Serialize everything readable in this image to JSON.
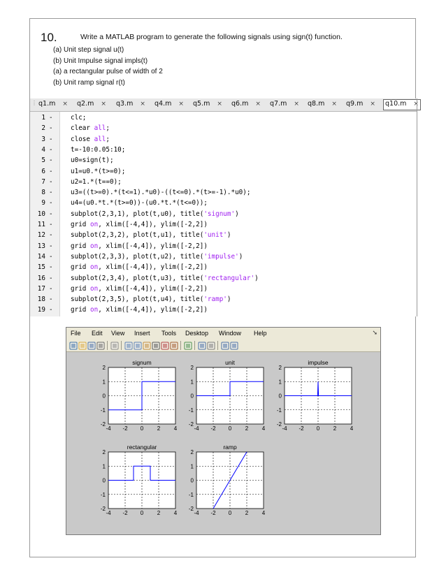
{
  "question": {
    "number": "10.",
    "text": "Write a MATLAB program to generate the following signals using sign(t) function.",
    "items": [
      "(a) Unit step signal u(t)",
      "(b) Unit Impulse signal impls(t)",
      "(a) a rectangular pulse of width of 2",
      "(b) Unit ramp signal r(t)"
    ]
  },
  "editor": {
    "tabs": [
      {
        "label": "q1.m"
      },
      {
        "label": "q2.m"
      },
      {
        "label": "q3.m"
      },
      {
        "label": "q4.m"
      },
      {
        "label": "q5.m"
      },
      {
        "label": "q6.m"
      },
      {
        "label": "q7.m"
      },
      {
        "label": "q8.m"
      },
      {
        "label": "q9.m"
      },
      {
        "label": "q10.m",
        "active": true
      }
    ],
    "close_glyph": "×",
    "lines": [
      {
        "num": "1",
        "code": [
          [
            "clc;",
            ""
          ]
        ]
      },
      {
        "num": "2",
        "code": [
          [
            "clear ",
            ""
          ],
          [
            "all",
            "kw"
          ],
          [
            ";",
            ""
          ]
        ]
      },
      {
        "num": "3",
        "code": [
          [
            "close ",
            ""
          ],
          [
            "all",
            "kw"
          ],
          [
            ";",
            ""
          ]
        ]
      },
      {
        "num": "4",
        "code": [
          [
            "t=-10:0.05:10;",
            ""
          ]
        ]
      },
      {
        "num": "5",
        "code": [
          [
            "u0=sign(t);",
            ""
          ]
        ]
      },
      {
        "num": "6",
        "code": [
          [
            "u1=u0.*(t>=0);",
            ""
          ]
        ]
      },
      {
        "num": "7",
        "code": [
          [
            "u2=1.*(t==0);",
            ""
          ]
        ]
      },
      {
        "num": "8",
        "code": [
          [
            "u3=((t>=0).*(t<=1).*u0)-((t<=0).*(t>=-1).*u0);",
            ""
          ]
        ]
      },
      {
        "num": "9",
        "code": [
          [
            "u4=(u0.*t.*(t>=0))-(u0.*t.*(t<=0));",
            ""
          ]
        ]
      },
      {
        "num": "10",
        "code": [
          [
            "subplot(2,3,1), plot(t,u0), title(",
            ""
          ],
          [
            "'signum'",
            "str"
          ],
          [
            ")",
            ""
          ]
        ]
      },
      {
        "num": "11",
        "code": [
          [
            "grid ",
            ""
          ],
          [
            "on",
            "kw"
          ],
          [
            ", xlim([-4,4]), ylim([-2,2])",
            ""
          ]
        ]
      },
      {
        "num": "12",
        "code": [
          [
            "subplot(2,3,2), plot(t,u1), title(",
            ""
          ],
          [
            "'unit'",
            "str"
          ],
          [
            ")",
            ""
          ]
        ]
      },
      {
        "num": "13",
        "code": [
          [
            "grid ",
            ""
          ],
          [
            "on",
            "kw"
          ],
          [
            ", xlim([-4,4]), ylim([-2,2])",
            ""
          ]
        ]
      },
      {
        "num": "14",
        "code": [
          [
            "subplot(2,3,3), plot(t,u2), title(",
            ""
          ],
          [
            "'impulse'",
            "str"
          ],
          [
            ")",
            ""
          ]
        ]
      },
      {
        "num": "15",
        "code": [
          [
            "grid ",
            ""
          ],
          [
            "on",
            "kw"
          ],
          [
            ", xlim([-4,4]), ylim([-2,2])",
            ""
          ]
        ]
      },
      {
        "num": "16",
        "code": [
          [
            "subplot(2,3,4), plot(t,u3), title(",
            ""
          ],
          [
            "'rectangular'",
            "str"
          ],
          [
            ")",
            ""
          ]
        ]
      },
      {
        "num": "17",
        "code": [
          [
            "grid ",
            ""
          ],
          [
            "on",
            "kw"
          ],
          [
            ", xlim([-4,4]), ylim([-2,2])",
            ""
          ]
        ]
      },
      {
        "num": "18",
        "code": [
          [
            "subplot(2,3,5), plot(t,u4), title(",
            ""
          ],
          [
            "'ramp'",
            "str"
          ],
          [
            ")",
            ""
          ]
        ]
      },
      {
        "num": "19",
        "code": [
          [
            "grid ",
            ""
          ],
          [
            "on",
            "kw"
          ],
          [
            ", xlim([-4,4]), ylim([-2,2])",
            ""
          ]
        ]
      }
    ],
    "line_marker": "-",
    "colors": {
      "keyword": "#a020f0",
      "string": "#a020f0",
      "text": "#000000"
    }
  },
  "figure": {
    "menu": [
      "File",
      "Edit",
      "View",
      "Insert",
      "Tools",
      "Desktop",
      "Window",
      "Help"
    ],
    "menu_arrow": "➘",
    "toolbar_icons": [
      "new-figure-icon",
      "open-icon",
      "save-icon",
      "print-icon",
      "sep",
      "edit-plot-icon",
      "sep",
      "zoom-in-icon",
      "zoom-out-icon",
      "pan-icon",
      "rotate-3d-icon",
      "data-cursor-icon",
      "brush-icon",
      "sep",
      "link-plot-icon",
      "sep",
      "colorbar-icon",
      "legend-icon",
      "sep",
      "hide-plot-tools-icon",
      "show-plot-tools-icon"
    ],
    "background_color": "#c9c9c9",
    "line_color": "#0000ff"
  },
  "chart_data": [
    {
      "type": "line",
      "title": "signum",
      "xlim": [
        -4,
        4
      ],
      "ylim": [
        -2,
        2
      ],
      "grid": true,
      "xticks": [
        -4,
        -2,
        0,
        2,
        4
      ],
      "yticks": [
        -2,
        -1,
        0,
        1,
        2
      ],
      "series": [
        {
          "x": [
            -4,
            0,
            0,
            4
          ],
          "y": [
            -1,
            -1,
            1,
            1
          ]
        }
      ]
    },
    {
      "type": "line",
      "title": "unit",
      "xlim": [
        -4,
        4
      ],
      "ylim": [
        -2,
        2
      ],
      "grid": true,
      "xticks": [
        -4,
        -2,
        0,
        2,
        4
      ],
      "yticks": [
        -2,
        -1,
        0,
        1,
        2
      ],
      "series": [
        {
          "x": [
            -4,
            0,
            0,
            4
          ],
          "y": [
            0,
            0,
            1,
            1
          ]
        }
      ]
    },
    {
      "type": "line",
      "title": "impulse",
      "xlim": [
        -4,
        4
      ],
      "ylim": [
        -2,
        2
      ],
      "grid": true,
      "xticks": [
        -4,
        -2,
        0,
        2,
        4
      ],
      "yticks": [
        -2,
        -1,
        0,
        1,
        2
      ],
      "series": [
        {
          "x": [
            -4,
            -0.05,
            0,
            0.05,
            4
          ],
          "y": [
            0,
            0,
            1,
            0,
            0
          ]
        }
      ]
    },
    {
      "type": "line",
      "title": "rectangular",
      "xlim": [
        -4,
        4
      ],
      "ylim": [
        -2,
        2
      ],
      "grid": true,
      "xticks": [
        -4,
        -2,
        0,
        2,
        4
      ],
      "yticks": [
        -2,
        -1,
        0,
        1,
        2
      ],
      "series": [
        {
          "x": [
            -4,
            -1,
            -1,
            0,
            0,
            1,
            1,
            4
          ],
          "y": [
            0,
            0,
            1,
            1,
            1,
            1,
            0,
            0
          ]
        }
      ]
    },
    {
      "type": "line",
      "title": "ramp",
      "xlim": [
        -4,
        4
      ],
      "ylim": [
        -2,
        2
      ],
      "grid": true,
      "xticks": [
        -4,
        -2,
        0,
        2,
        4
      ],
      "yticks": [
        -2,
        -1,
        0,
        1,
        2
      ],
      "series": [
        {
          "x": [
            -4,
            4
          ],
          "y": [
            -4,
            4
          ]
        }
      ]
    }
  ]
}
